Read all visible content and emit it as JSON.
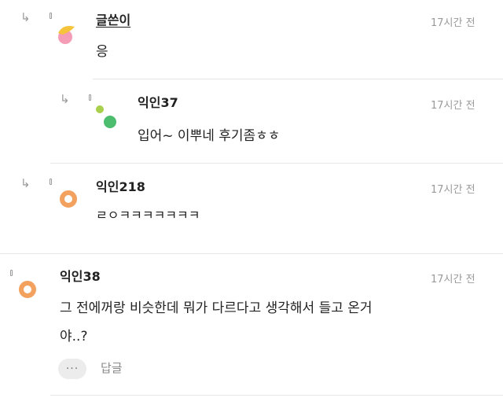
{
  "comments": [
    {
      "author": "글쓴이",
      "time": "17시간 전",
      "text": "응"
    },
    {
      "author": "익인37",
      "time": "17시간 전",
      "text": "입어~ 이뿌네 후기좀ㅎㅎ"
    },
    {
      "author": "익인218",
      "time": "17시간 전",
      "text": "ㄹㅇㅋㅋㅋㅋㅋㅋㅋ"
    },
    {
      "author": "익인38",
      "time": "17시간 전",
      "text_line1": "그 전에꺼랑 비슷한데 뭐가 다르다고 생각해서 들고 온거",
      "text_line2": "야..?"
    }
  ],
  "actions": {
    "more_label": "···",
    "reply_label": "답글"
  },
  "icons": {
    "reply": "reply-arrow-icon",
    "more": "more-dots-icon",
    "avatar": "avatar-icon"
  },
  "colors": {
    "avatar_orange": "#f3a15f",
    "avatar_green": "#4cbc6e",
    "avatar_yellow": "#f5c43a",
    "avatar_pink": "#f59cb6"
  }
}
